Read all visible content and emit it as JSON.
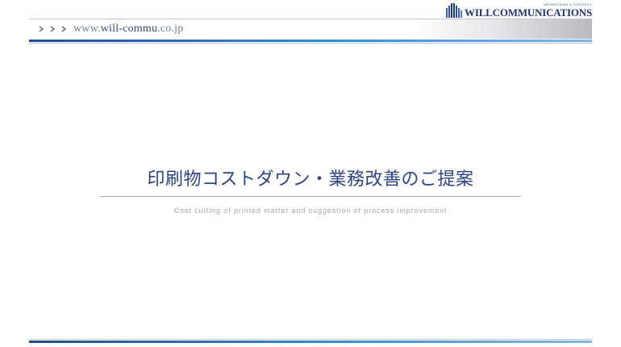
{
  "brand": {
    "tagline": "ADVERTISING & STRATEGY",
    "name": "WILLCOMMUNICATIONS"
  },
  "header": {
    "url_prefix": "www.",
    "url_domain": "will-commu",
    "url_suffix": ".co.jp"
  },
  "slide": {
    "title": "印刷物コストダウン・業務改善のご提案",
    "subtitle": "Cost cutting of printed matter and suggestion of process improvement"
  },
  "colors": {
    "accent_blue": "#2e4481",
    "rule_blue": "#3e8bd0"
  }
}
